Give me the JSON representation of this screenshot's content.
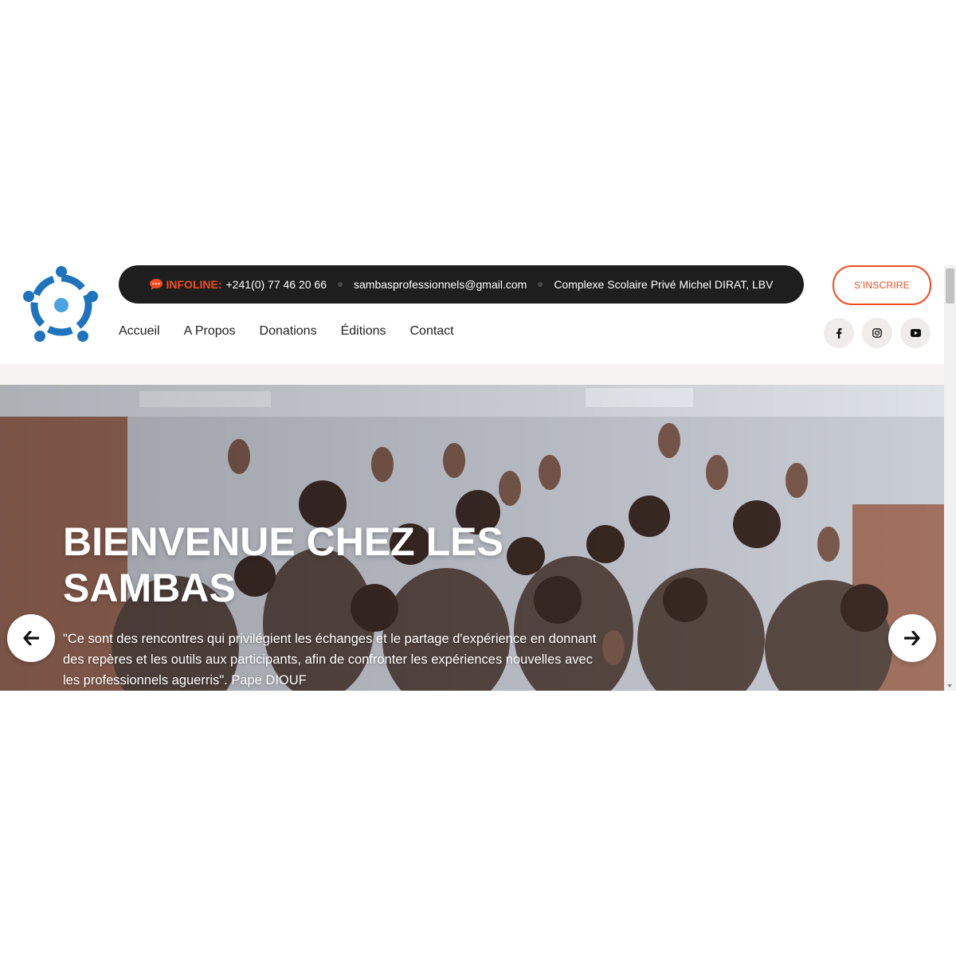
{
  "topbar": {
    "infoline_label": "INFOLINE:",
    "phone": "+241(0) 77 46 20 66",
    "email": "sambasprofessionnels@gmail.com",
    "address": "Complexe Scolaire Privé Michel DIRAT, LBV"
  },
  "nav": {
    "items": [
      {
        "label": "Accueil"
      },
      {
        "label": "A Propos"
      },
      {
        "label": "Donations"
      },
      {
        "label": "Éditions"
      },
      {
        "label": "Contact"
      }
    ]
  },
  "cta": {
    "label": "S'INSCRIRE"
  },
  "socials": [
    {
      "icon": "facebook-icon"
    },
    {
      "icon": "instagram-icon"
    },
    {
      "icon": "youtube-icon"
    }
  ],
  "hero": {
    "title": "BIENVENUE CHEZ LES SAMBAS",
    "quote": "\"Ce sont des rencontres qui privilégient les échanges et le partage d'expérience en donnant des repères et les outils aux participants, afin de confronter les expériences nouvelles avec les professionnels aguerris\". Pape DIOUF"
  },
  "colors": {
    "accent": "#f04e23",
    "topbar_bg": "#1e1e1e",
    "logo_blue": "#1e73be"
  }
}
